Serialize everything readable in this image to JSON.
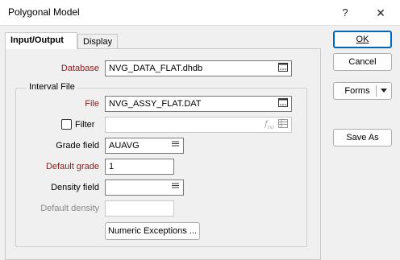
{
  "window": {
    "title": "Polygonal Model",
    "help_glyph": "?",
    "close_glyph": "✕"
  },
  "tabs": [
    {
      "label": "Input/Output",
      "active": true
    },
    {
      "label": "Display",
      "active": false
    }
  ],
  "form": {
    "database": {
      "label": "Database",
      "value": "NVG_DATA_FLAT.dhdb"
    },
    "interval_file": {
      "group_label": "Interval File",
      "file": {
        "label": "File",
        "value": "NVG_ASSY_FLAT.DAT"
      },
      "filter": {
        "label": "Filter",
        "checked": false,
        "value": ""
      },
      "grade_field": {
        "label": "Grade field",
        "value": "AUAVG"
      },
      "default_grade": {
        "label": "Default grade",
        "value": "1"
      },
      "density_field": {
        "label": "Density field",
        "value": ""
      },
      "default_density": {
        "label": "Default density",
        "value": ""
      },
      "numeric_exceptions_label": "Numeric Exceptions ..."
    }
  },
  "side_buttons": {
    "ok_label": "OK",
    "cancel_label": "Cancel",
    "forms_label": "Forms",
    "save_as_label": "Save As"
  },
  "colors": {
    "required_label": "#8b1a1a",
    "primary_border": "#0067c0",
    "disabled_label": "#8a8a8a"
  },
  "icons": [
    "browse-icon",
    "function-icon",
    "list-icon",
    "dropdown-arrow-icon"
  ]
}
